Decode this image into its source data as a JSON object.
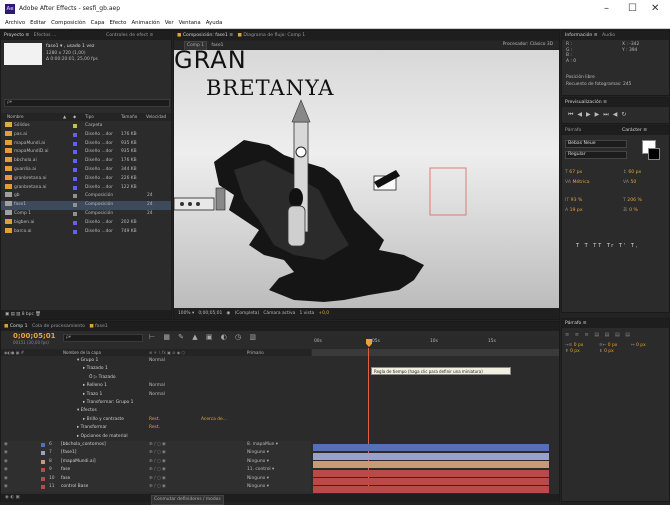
{
  "window": {
    "title": "Adobe After Effects - sesfi_gb.aep",
    "logo": "Ae"
  },
  "menu": [
    "Archivo",
    "Editar",
    "Composición",
    "Capa",
    "Efecto",
    "Animación",
    "Ver",
    "Ventana",
    "Ayuda"
  ],
  "project": {
    "tabs": [
      "Proyecto ≡",
      "Efectos ..."
    ],
    "tab_right": "Controles de efect ≡",
    "selected_name": "fase1 ▾ , usado 1 vez",
    "selected_info1": "1280 x 720 (1,00)",
    "selected_info2": "Δ 0:00:20:01, 25,00 fps",
    "search_placeholder": "ρ▾",
    "columns": [
      "Nombre",
      "▲",
      "◆",
      "Tipo",
      "Tamaño",
      "Velocidad"
    ],
    "items": [
      {
        "name": "Sólidos",
        "type": "Carpeta",
        "size": "",
        "fps": "",
        "color": "#c0c050",
        "kind": "folder"
      },
      {
        "name": "pas.ai",
        "type": "Diseño ...dor",
        "size": "176 KB",
        "fps": "",
        "color": "#6060ff",
        "kind": "file"
      },
      {
        "name": "mapaMundi.ai",
        "type": "Diseño ...dor",
        "size": "935 KB",
        "fps": "",
        "color": "#6060ff",
        "kind": "file"
      },
      {
        "name": "mapaMundiD.ai",
        "type": "Diseño ...dor",
        "size": "935 KB",
        "fps": "",
        "color": "#6060ff",
        "kind": "file"
      },
      {
        "name": "bbchola.ai",
        "type": "Diseño ...dor",
        "size": "176 KB",
        "fps": "",
        "color": "#6060ff",
        "kind": "file"
      },
      {
        "name": "guardia.ai",
        "type": "Diseño ...dor",
        "size": "344 KB",
        "fps": "",
        "color": "#6060ff",
        "kind": "file"
      },
      {
        "name": "granbretana.ai",
        "type": "Diseño ...dor",
        "size": "226 KB",
        "fps": "",
        "color": "#6060ff",
        "kind": "file"
      },
      {
        "name": "granbretana.ai",
        "type": "Diseño ...dor",
        "size": "122 KB",
        "fps": "",
        "color": "#6060ff",
        "kind": "file"
      },
      {
        "name": "gb",
        "type": "Composición",
        "size": "",
        "fps": "24",
        "color": "#909090",
        "kind": "comp"
      },
      {
        "name": "fase1",
        "type": "Composición",
        "size": "",
        "fps": "24",
        "color": "#909090",
        "kind": "comp"
      },
      {
        "name": "Comp 1",
        "type": "Composición",
        "size": "",
        "fps": "24",
        "color": "#909090",
        "kind": "comp"
      },
      {
        "name": "bigben.ai",
        "type": "Diseño ...dor",
        "size": "202 KB",
        "fps": "",
        "color": "#6060ff",
        "kind": "file"
      },
      {
        "name": "barco.ai",
        "type": "Diseño ...dor",
        "size": "749 KB",
        "fps": "",
        "color": "#6060ff",
        "kind": "file"
      }
    ],
    "footer": "8 bpc"
  },
  "composition": {
    "tabs": [
      "Composición: fase1 ≡",
      "Diagrama de flujo: Comp 1"
    ],
    "subtabs": [
      "Comp 1",
      "fase1"
    ],
    "renderer": "Procesador: Clásico 3D",
    "canvas_text1": "GRAN",
    "canvas_text2": "BRETANYA",
    "footer": [
      "100%",
      "0;00;05;01",
      "(Completa)",
      "Cámara activa",
      "1 vista",
      "+0,0"
    ]
  },
  "info": {
    "tabs": [
      "Información ≡",
      "Audio"
    ],
    "r": "R :",
    "g": "G :",
    "b": "B :",
    "a": "A : 0",
    "x": "X : -342",
    "y": "Y : 394",
    "preview_label": "Posición libre",
    "preview_text": "Recuento de fotogramas: 245"
  },
  "preview": {
    "title": "Previsualización ≡"
  },
  "character": {
    "tabs": [
      "Párrafo",
      "Carácter ≡"
    ],
    "font": "Bebas Neue",
    "style": "Regular",
    "size": "67 px",
    "leading": "60 px",
    "tracking": "50",
    "kerning": "Métrica",
    "scale_v": "93 %",
    "scale_h": "206 %",
    "baseline": "19 px",
    "tsume": "0 %",
    "styles_row": "T T TT Tr T' T,"
  },
  "paragraph": {
    "title": "Párrafo ≡",
    "indent1": "0 px",
    "indent2": "0 px",
    "indent3": "0 px",
    "space1": "0 px",
    "space2": "0 px"
  },
  "timeline": {
    "tabs": [
      "Comp 1",
      "Cola de procesamiento",
      "fase1"
    ],
    "timecode": "0;00;05;01",
    "subtime": "00151 (30,00 fps)",
    "search_placeholder": "ρ▾",
    "col_name": "Nombre de la capa",
    "col_parent": "Primario",
    "ruler": [
      "00s",
      "05s",
      "10s",
      "15s"
    ],
    "tooltip": "Regla de tiempo (haga clic para definir una miniatura)",
    "layers": [
      {
        "num": "",
        "name": "▾ Grupo 1",
        "mode": "Normal",
        "parent": "",
        "indent": 1
      },
      {
        "num": "",
        "name": "▸ Trazado 1",
        "mode": "",
        "parent": "",
        "indent": 2
      },
      {
        "num": "",
        "name": "Ö ▷ Trazado",
        "mode": "",
        "parent": "",
        "indent": 3
      },
      {
        "num": "",
        "name": "▸ Relleno 1",
        "mode": "Normal",
        "parent": "",
        "indent": 2
      },
      {
        "num": "",
        "name": "▸ Trazo 1",
        "mode": "Normal",
        "parent": "",
        "indent": 2
      },
      {
        "num": "",
        "name": "▸ Transformar: Grupo 1",
        "mode": "",
        "parent": "",
        "indent": 2
      },
      {
        "num": "",
        "name": "▾ Efectos",
        "mode": "",
        "parent": "",
        "indent": 1
      },
      {
        "num": "",
        "name": "▸ Brillo y contraste",
        "mode": "Rest.",
        "parent": "Acerca de...",
        "indent": 2
      },
      {
        "num": "",
        "name": "▸ Transformar",
        "mode": "Rest.",
        "parent": "",
        "indent": 1
      },
      {
        "num": "",
        "name": "▸ Opciones de material",
        "mode": "",
        "parent": "",
        "indent": 1
      },
      {
        "num": "6",
        "name": "[bbchola_contornos]",
        "mode": "",
        "parent": "8. mapaMun ▾",
        "indent": 0
      },
      {
        "num": "7",
        "name": "[fase1]",
        "mode": "",
        "parent": "Ninguno ▾",
        "indent": 0
      },
      {
        "num": "8",
        "name": "[mapaMundi.ai]",
        "mode": "",
        "parent": "Ninguno ▾",
        "indent": 0
      },
      {
        "num": "9",
        "name": "fase",
        "mode": "",
        "parent": "11. control ▾",
        "indent": 0
      },
      {
        "num": "10",
        "name": "fase",
        "mode": "",
        "parent": "Ninguno ▾",
        "indent": 0
      },
      {
        "num": "11",
        "name": "control Base",
        "mode": "",
        "parent": "Ninguno ▾",
        "indent": 0
      }
    ],
    "footer": "Conmutar definidores / modos"
  }
}
